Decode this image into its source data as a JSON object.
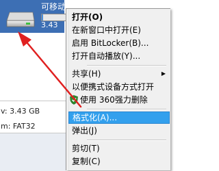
{
  "drive": {
    "name": "可移动磁盘",
    "size_fragment": "3.43",
    "usage_fraction": 0.06
  },
  "details": {
    "capacity_line": "v: 3.43 GB",
    "filesystem_line": "m: FAT32"
  },
  "context_menu": {
    "items": [
      {
        "label": "打开(O)",
        "bold": true
      },
      {
        "label": "在新窗口中打开(E)"
      },
      {
        "label": "启用 BitLocker(B)..."
      },
      {
        "label": "打开自动播放(Y)..."
      },
      {
        "label": "共享(H)",
        "submenu": true
      },
      {
        "label": "以便携式设备方式打开"
      },
      {
        "label": "使用 360强力删除",
        "icon": "360-shield-icon"
      },
      {
        "label": "格式化(A)...",
        "highlighted": true
      },
      {
        "label": "弹出(J)"
      },
      {
        "label": "剪切(T)"
      },
      {
        "label": "复制(C)"
      }
    ]
  },
  "colors": {
    "highlight": "#33a0ed",
    "arrow": "#e02020",
    "drive_tile": "#3d6fb4"
  }
}
